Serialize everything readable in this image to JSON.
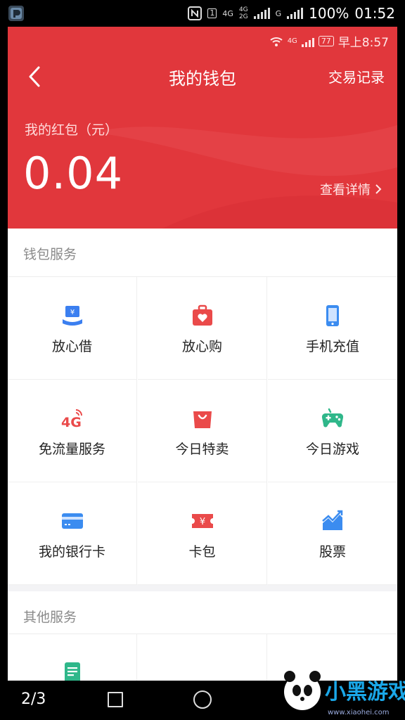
{
  "outer_status": {
    "icons": [
      "app-icon",
      "nfc-icon",
      "sim-1-icon",
      "4g-icon",
      "4g-2g-icon",
      "g-icon",
      "signal-icon"
    ],
    "sim_label": "1",
    "net_4g": "4G",
    "net_4g_2g_top": "4G",
    "net_4g_2g_bottom": "2G",
    "net_g": "G",
    "battery": "100%",
    "time": "01:52"
  },
  "inner_status": {
    "net": "4G",
    "battery": "77",
    "time": "早上8:57"
  },
  "header": {
    "title": "我的钱包",
    "right_link": "交易记录",
    "red_envelope_label": "我的红包（元）",
    "red_envelope_amount": "0.04",
    "details_link": "查看详情",
    "background_color": "#e1373c"
  },
  "wallet_services": {
    "title": "钱包服务",
    "items": [
      {
        "label": "放心借",
        "icon": "loan-icon",
        "color": "#3b7ff0"
      },
      {
        "label": "放心购",
        "icon": "shopping-bag-heart-icon",
        "color": "#ea4a4a"
      },
      {
        "label": "手机充值",
        "icon": "phone-icon",
        "color": "#3b8cf0"
      },
      {
        "label": "免流量服务",
        "icon": "4g-data-icon",
        "color": "#ea4a4a"
      },
      {
        "label": "今日特卖",
        "icon": "sale-bag-icon",
        "color": "#ea4a4a"
      },
      {
        "label": "今日游戏",
        "icon": "gamepad-icon",
        "color": "#2fb78a"
      },
      {
        "label": "我的银行卡",
        "icon": "bank-card-icon",
        "color": "#3b8cf0"
      },
      {
        "label": "卡包",
        "icon": "ticket-icon",
        "color": "#ea4a4a"
      },
      {
        "label": "股票",
        "icon": "stock-chart-icon",
        "color": "#3b8cf0"
      }
    ]
  },
  "other_services": {
    "title": "其他服务",
    "items": [
      {
        "label": "",
        "icon": "document-icon",
        "color": "#2fb78a"
      }
    ]
  },
  "bottom_bar": {
    "page_indicator": "2/3",
    "icons": [
      "recent-apps-icon",
      "home-icon"
    ]
  },
  "watermark": {
    "text": "小黑游戏",
    "url": "www.xiaohei.com"
  }
}
